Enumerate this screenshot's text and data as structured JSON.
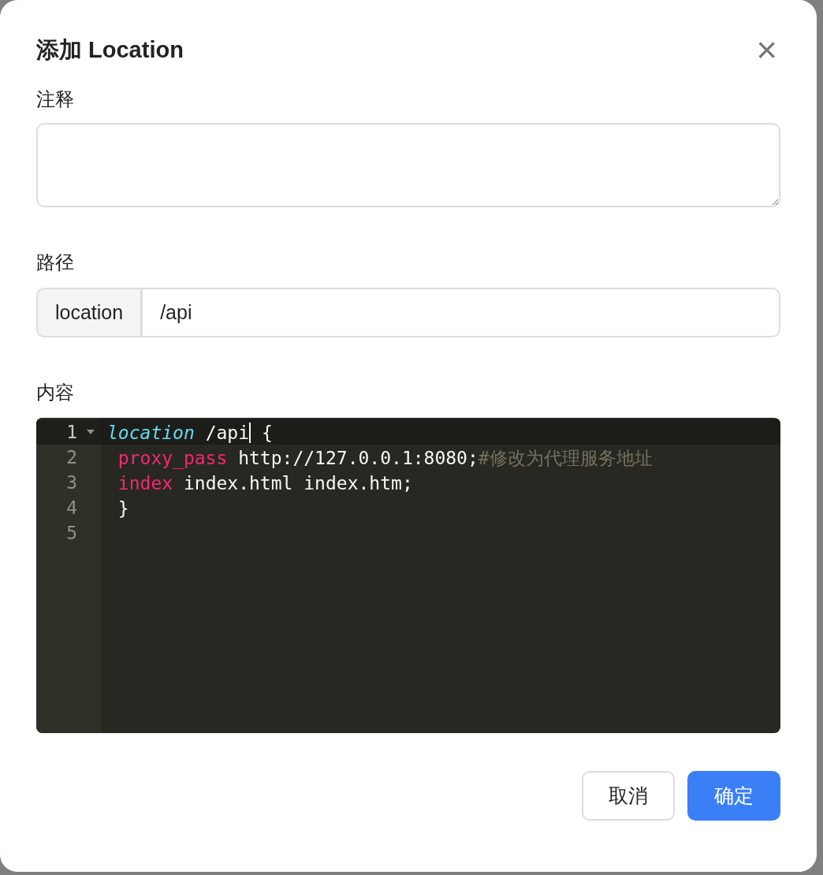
{
  "dialog": {
    "title": "添加 Location",
    "close": "×"
  },
  "comment_field": {
    "label": "注释"
  },
  "path_field": {
    "label": "路径",
    "prefix": "location",
    "value": "/api"
  },
  "content_editor": {
    "label": "内容",
    "lines": [
      {
        "number": "1",
        "active": true,
        "foldable": true,
        "tokens": [
          {
            "kind": "directive",
            "text": "location"
          },
          {
            "kind": "plain",
            "text": " /api",
            "cursor": true
          },
          {
            "kind": "plain",
            "text": " {"
          }
        ]
      },
      {
        "number": "2",
        "active": false,
        "foldable": false,
        "tokens": [
          {
            "kind": "keyword",
            "text": " proxy_pass"
          },
          {
            "kind": "plain",
            "text": " http://127.0.0.1:8080;"
          },
          {
            "kind": "comment",
            "text": "#修改为代理服务地址"
          }
        ]
      },
      {
        "number": "3",
        "active": false,
        "foldable": false,
        "tokens": [
          {
            "kind": "keyword",
            "text": " index"
          },
          {
            "kind": "plain",
            "text": " index.html index.htm;"
          }
        ]
      },
      {
        "number": "4",
        "active": false,
        "foldable": false,
        "tokens": [
          {
            "kind": "plain",
            "text": " }"
          }
        ]
      },
      {
        "number": "5",
        "active": false,
        "foldable": false
      }
    ]
  },
  "buttons": [
    {
      "label": "取消",
      "kind": "secondary"
    },
    {
      "label": "确定",
      "kind": "primary"
    }
  ]
}
